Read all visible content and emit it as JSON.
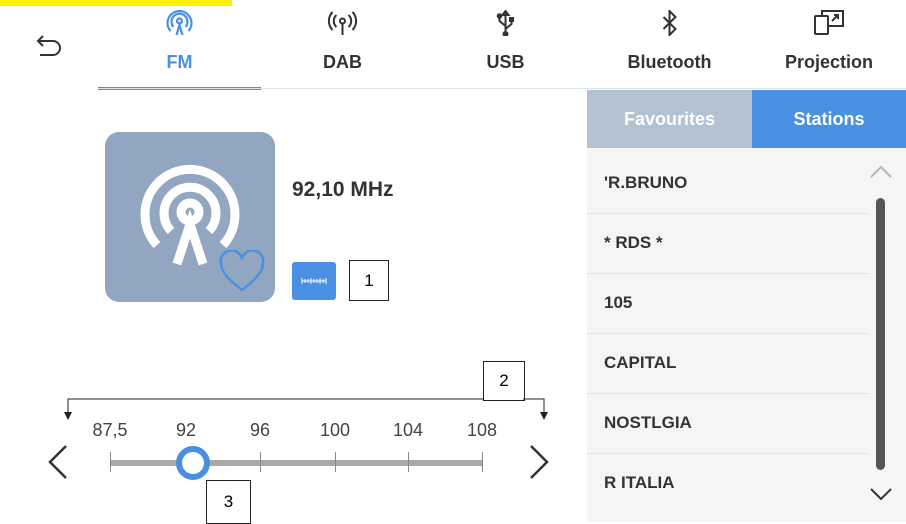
{
  "nav": {
    "tabs": [
      {
        "label": "FM",
        "icon": "fm-radio-icon"
      },
      {
        "label": "DAB",
        "icon": "dab-antenna-icon"
      },
      {
        "label": "USB",
        "icon": "usb-icon"
      },
      {
        "label": "Bluetooth",
        "icon": "bluetooth-icon"
      },
      {
        "label": "Projection",
        "icon": "projection-icon"
      }
    ],
    "active_tab": "FM"
  },
  "now_playing": {
    "frequency": "92,10 MHz",
    "favourite": false
  },
  "callouts": {
    "c1": "1",
    "c2": "2",
    "c3": "3"
  },
  "tuner": {
    "scale_labels": [
      "87,5",
      "92",
      "96",
      "100",
      "104",
      "108"
    ],
    "current_mhz": 92.1
  },
  "panel": {
    "favourites_label": "Favourites",
    "stations_label": "Stations",
    "active_segment": "Stations",
    "stations": [
      "'R.BRUNO",
      "* RDS *",
      "105",
      "CAPITAL",
      "NOSTLGIA",
      "R ITALIA"
    ]
  },
  "colors": {
    "accent": "#4a90e2",
    "art_bg": "#93a6c1",
    "inactive_segment": "#b3c2d2"
  }
}
